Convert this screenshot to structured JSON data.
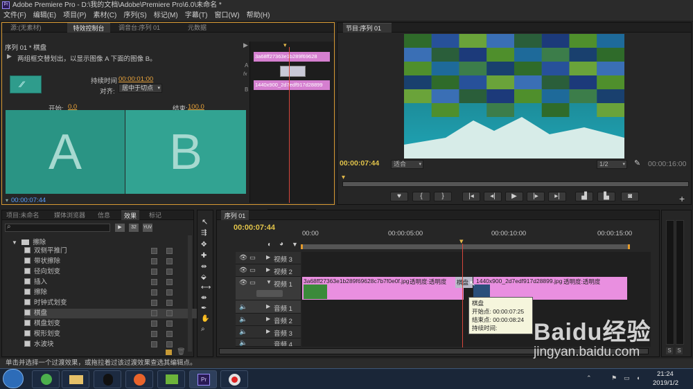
{
  "window": {
    "title": "Adobe Premiere Pro - D:\\我的文档\\Adobe\\Premiere Pro\\6.0\\未命名 *",
    "logo": "Pr"
  },
  "menu": [
    "文件(F)",
    "编辑(E)",
    "项目(P)",
    "素材(C)",
    "序列(S)",
    "标记(M)",
    "字幕(T)",
    "窗口(W)",
    "帮助(H)"
  ],
  "effect_controls": {
    "tabs": [
      "源:(无素材)",
      "特效控制台",
      "调音台:序列 01",
      "元数据"
    ],
    "sequence_label": "序列 01 * 棋盘",
    "description": "两组框交替划出，以显示图像 A 下面的图像 B。",
    "duration_label": "持续时间",
    "duration_value": "00:00:01:00",
    "align_label": "对齐:",
    "align_value": "居中于切点",
    "start_label": "开始:",
    "start_value": "0.0",
    "end_label": "结束:",
    "end_value": "100.0",
    "preview_a": "A",
    "preview_b": "B",
    "timecode": "00:00:07:44",
    "mini_clip_a": "3a68ff27363e1b289f69628",
    "mini_clip_b": "1440x900_2d7edf917d28899",
    "track_letters": [
      "A",
      "fx",
      "B"
    ]
  },
  "program_monitor": {
    "tab": "节目:序列 01",
    "timecode": "00:00:07:44",
    "fit": "适合",
    "resolution": "1/2",
    "duration": "00:00:16:00"
  },
  "project_panel": {
    "tabs": [
      "项目:未命名",
      "媒体浏览器",
      "信息",
      "效果",
      "标记"
    ],
    "folder": "擦除",
    "badges": [
      "32",
      "YUV"
    ],
    "effects": [
      "双侧平推门",
      "带状擦除",
      "径向划变",
      "插入",
      "擦除",
      "时钟式划变",
      "棋盘",
      "棋盘划变",
      "楔形划变",
      "水波块"
    ],
    "selected": "棋盘"
  },
  "timeline": {
    "tab": "序列 01",
    "timecode": "00:00:07:44",
    "ruler": [
      "00:00",
      "00:00:05:00",
      "00:00:10:00",
      "00:00:15:00"
    ],
    "video_tracks": [
      "视频 3",
      "视频 2",
      "视频 1"
    ],
    "audio_tracks": [
      "音频 1",
      "音频 2",
      "音频 3",
      "音频 4"
    ],
    "clip1_name": "3a68ff27363e1b289f69628c7b7f0e0f.jpg",
    "clip1_opacity": "透明度:透明度",
    "transition_name": "棋盘",
    "clip2_name": "1440x900_2d7edf917d28899.jpg",
    "clip2_opacity": "透明度:透明度"
  },
  "tooltip": {
    "title": "棋盘",
    "start": "开始点: 00:00:07:25",
    "end": "结束点: 00:00:08:24",
    "duration": "持续时间: 00:00:01:00"
  },
  "statusbar": "单击并选择一个过渡效果，或拖拉着过该过渡效果查选其编辑点。",
  "taskbar": {
    "time": "21:24",
    "date": "2019/1/2"
  },
  "watermark": {
    "brand": "Baidu经验",
    "url": "jingyan.baidu.com"
  },
  "colors": {
    "accent": "#e9a33b",
    "clip": "#e98fe0",
    "playhead": "#d9473c",
    "preview": "#2c9a8a"
  }
}
